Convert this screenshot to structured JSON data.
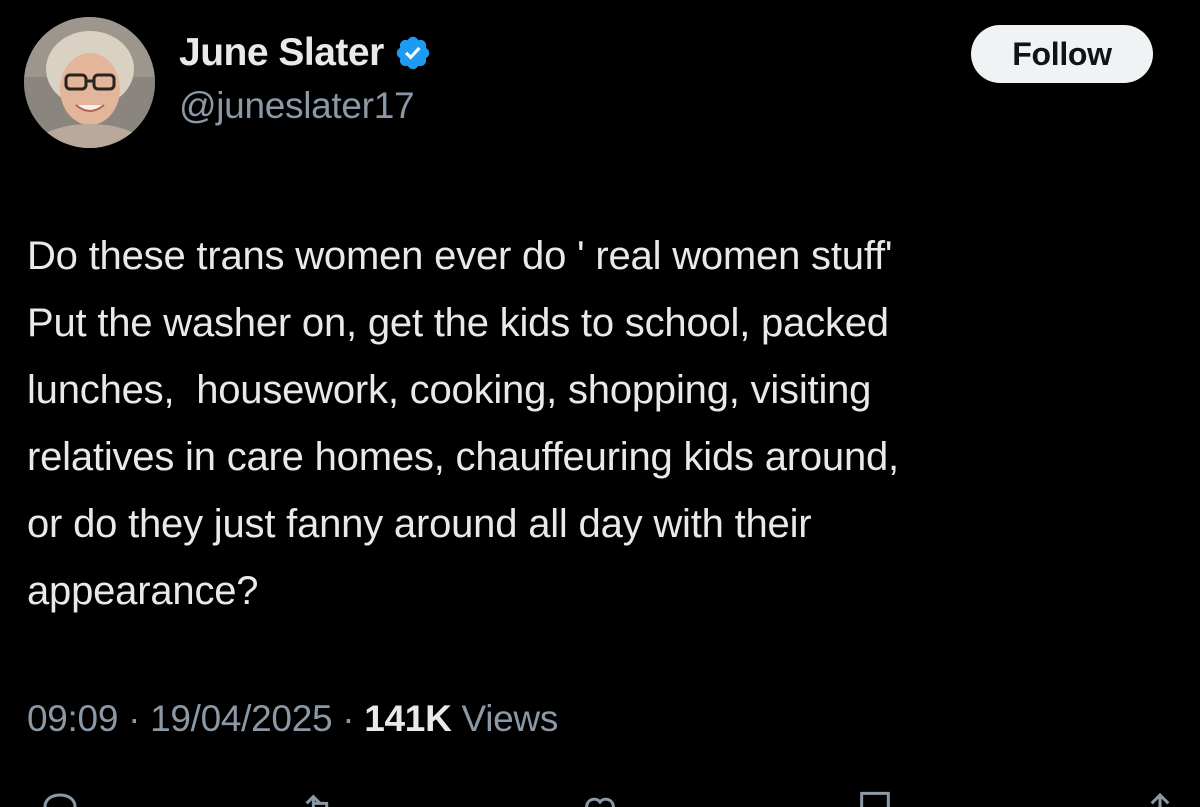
{
  "author": {
    "name": "June Slater",
    "handle": "@juneslater17",
    "verified": true,
    "badge_color": "#1d9bf0"
  },
  "follow_label": "Follow",
  "tweet": {
    "text": "Do these trans women ever do ' real women stuff'\nPut the washer on, get the kids to school, packed\nlunches,  housework, cooking, shopping, visiting\nrelatives in care homes, chauffeuring kids around,\nor do they just fanny around all day with their\nappearance?"
  },
  "meta": {
    "time": "09:09",
    "separator": " · ",
    "date": "19/04/2025",
    "views_count": "141K",
    "views_label": "Views"
  },
  "actions": [
    {
      "icon": "reply-icon"
    },
    {
      "icon": "retweet-icon"
    },
    {
      "icon": "like-icon"
    },
    {
      "icon": "bookmark-icon"
    },
    {
      "icon": "share-icon"
    }
  ],
  "colors": {
    "background": "#000000",
    "primary_text": "#e7e9ea",
    "secondary_text": "#8b98a5",
    "button_bg": "#eff3f4"
  }
}
